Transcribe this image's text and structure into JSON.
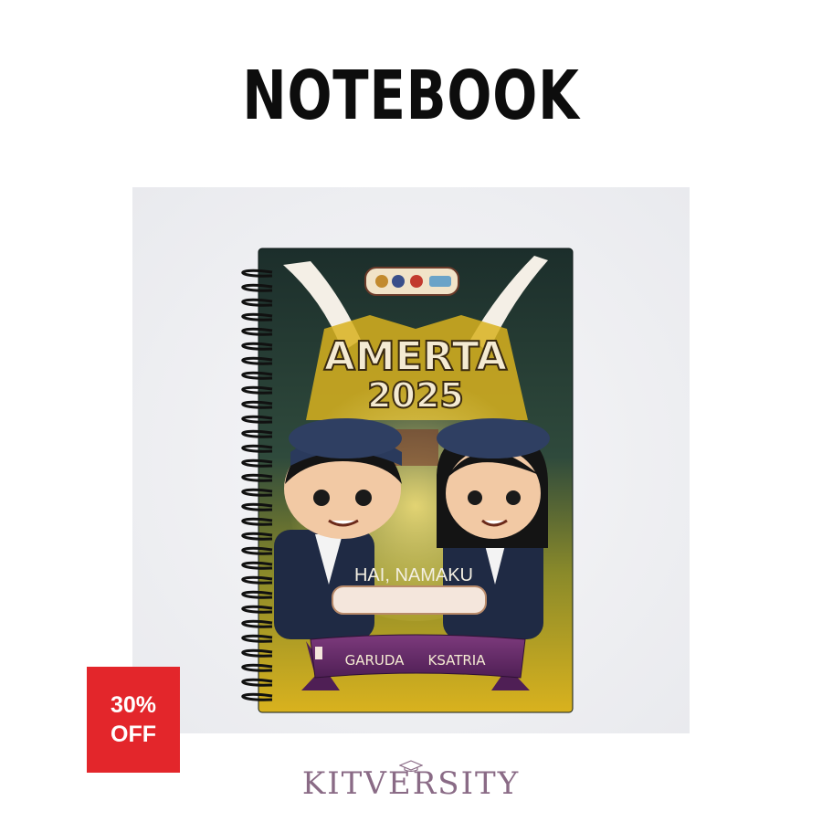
{
  "header": {
    "title": "NOTEBOOK"
  },
  "product": {
    "cover_title_line1": "AMERTA",
    "cover_title_line2": "2025",
    "name_prompt": "HAI, NAMAKU",
    "banner_left": "GARUDA",
    "banner_right": "KSATRIA"
  },
  "badge": {
    "line1": "30%",
    "line2": "OFF",
    "color": "#e3262b"
  },
  "brand": {
    "name": "KITVERSITY",
    "icon": "graduation-cap-icon"
  },
  "colors": {
    "cover_dark": "#1f3a37",
    "cover_yellow": "#d9b21e",
    "banner_purple": "#6b2f6b",
    "title_cream": "#f4ead2"
  }
}
